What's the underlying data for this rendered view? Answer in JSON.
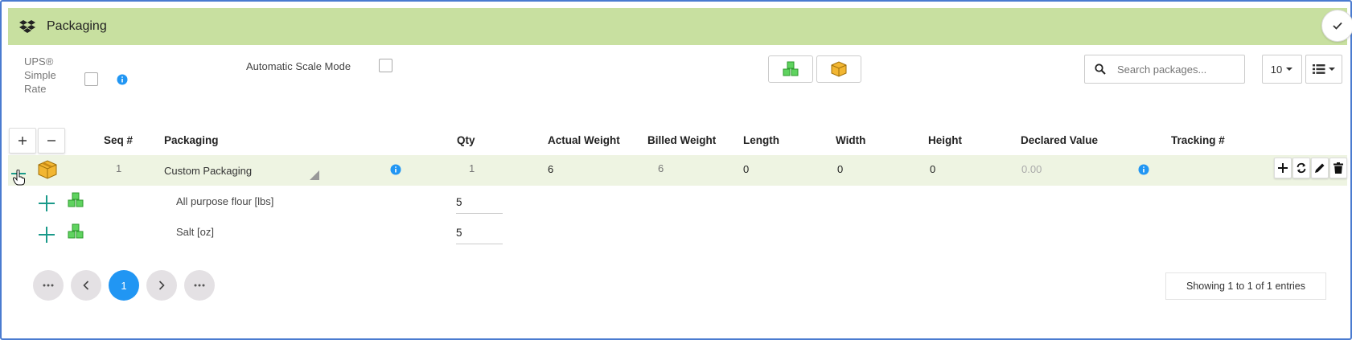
{
  "header": {
    "title": "Packaging",
    "icon": "dropbox-box-icon"
  },
  "controls": {
    "ups_label": "UPS® Simple Rate",
    "ups_label_lines": [
      "UPS®",
      "Simple",
      "Rate"
    ],
    "auto_scale_label": "Automatic Scale Mode",
    "search_placeholder": "Search packages...",
    "page_size": "10"
  },
  "table": {
    "columns": [
      "Seq #",
      "Packaging",
      "Qty",
      "Actual Weight",
      "Billed Weight",
      "Length",
      "Width",
      "Height",
      "Declared Value",
      "Tracking #"
    ],
    "package": {
      "seq": "1",
      "packaging": "Custom Packaging",
      "qty": "1",
      "actual_weight": "6",
      "billed_weight": "6",
      "length": "0",
      "width": "0",
      "height": "0",
      "declared_value": "0.00",
      "tracking": ""
    },
    "items": [
      {
        "name": "All purpose flour [lbs]",
        "qty": "5"
      },
      {
        "name": "Salt [oz]",
        "qty": "5"
      }
    ]
  },
  "pagination": {
    "current": "1",
    "summary": "Showing 1 to 1 of 1 entries"
  },
  "colors": {
    "header_bg": "#c8e0a0",
    "row_bg": "#eef4e2",
    "accent": "#2196f3",
    "plus_teal": "#1a9a8a"
  }
}
